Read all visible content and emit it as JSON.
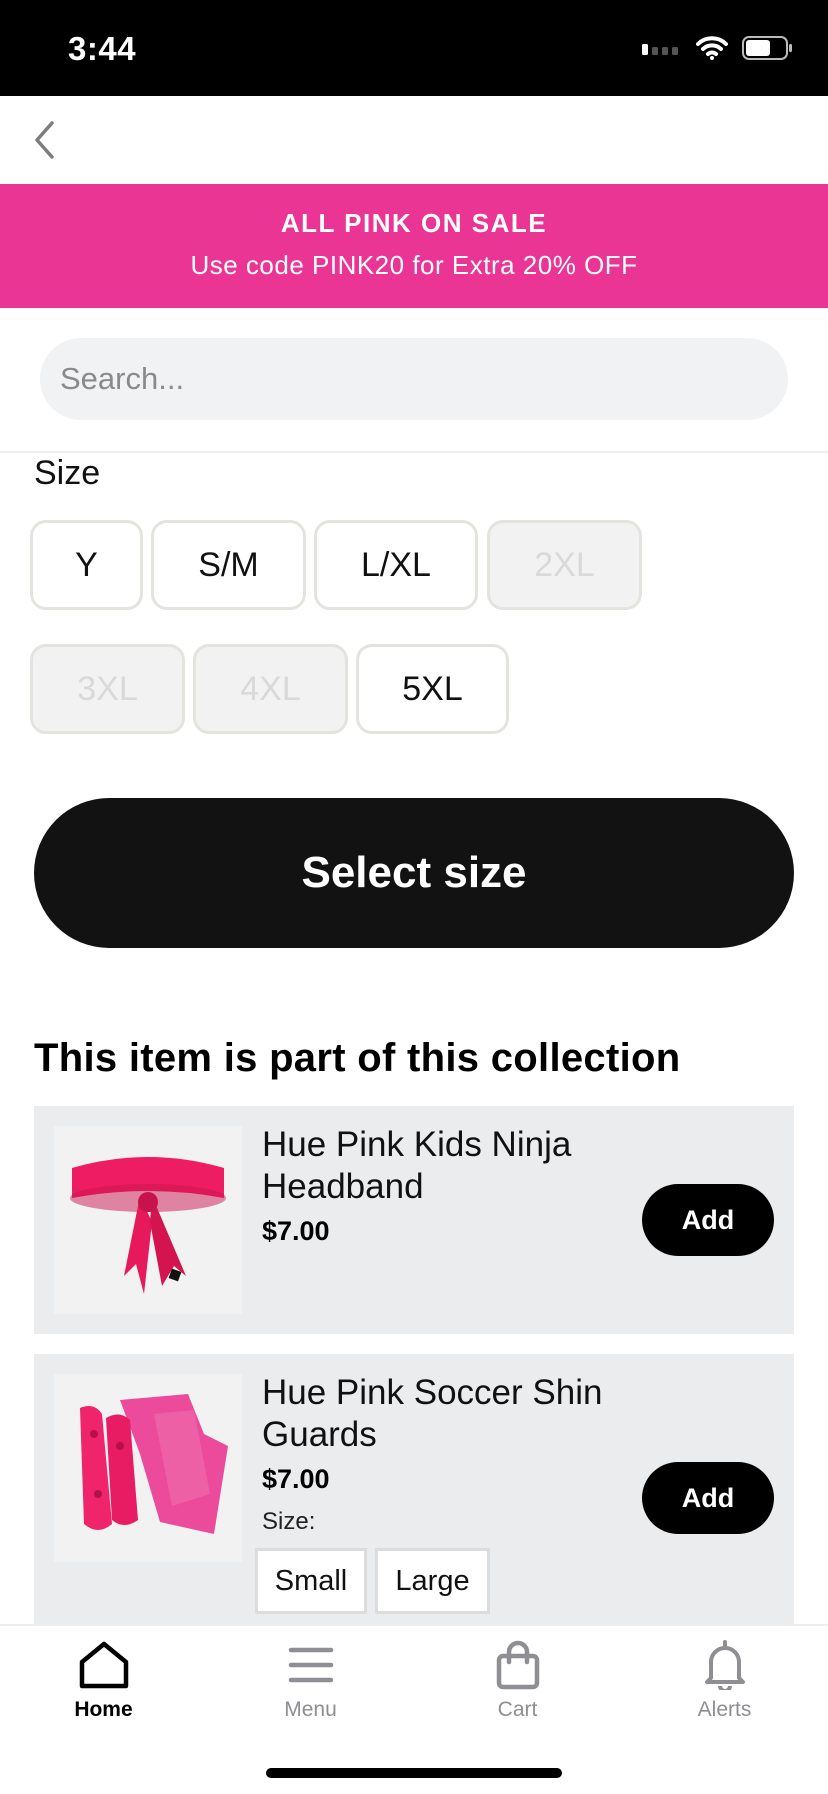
{
  "status_bar": {
    "time": "3:44"
  },
  "promo": {
    "line1": "ALL PINK ON SALE",
    "line2": "Use code PINK20 for Extra 20% OFF",
    "color": "#ea3594"
  },
  "search": {
    "placeholder": "Search...",
    "value": ""
  },
  "size": {
    "label": "Size",
    "options": [
      {
        "label": "Y",
        "available": true
      },
      {
        "label": "S/M",
        "available": true
      },
      {
        "label": "L/XL",
        "available": true
      },
      {
        "label": "2XL",
        "available": false
      },
      {
        "label": "3XL",
        "available": false
      },
      {
        "label": "4XL",
        "available": false
      },
      {
        "label": "5XL",
        "available": true
      }
    ]
  },
  "select_button": {
    "label": "Select size"
  },
  "collection": {
    "title": "This item is part of this collection",
    "products": [
      {
        "name": "Hue Pink Kids Ninja Headband",
        "price": "$7.00",
        "add_label": "Add",
        "image": "pink-headband"
      },
      {
        "name": "Hue Pink Soccer Shin Guards",
        "price": "$7.00",
        "add_label": "Add",
        "image": "pink-shin-guards",
        "size_label": "Size:",
        "size_options": [
          "Small",
          "Large"
        ]
      }
    ]
  },
  "tabbar": {
    "tabs": [
      {
        "label": "Home",
        "icon": "home-icon",
        "active": true
      },
      {
        "label": "Menu",
        "icon": "menu-icon",
        "active": false
      },
      {
        "label": "Cart",
        "icon": "bag-icon",
        "active": false
      },
      {
        "label": "Alerts",
        "icon": "bell-icon",
        "active": false
      }
    ]
  }
}
